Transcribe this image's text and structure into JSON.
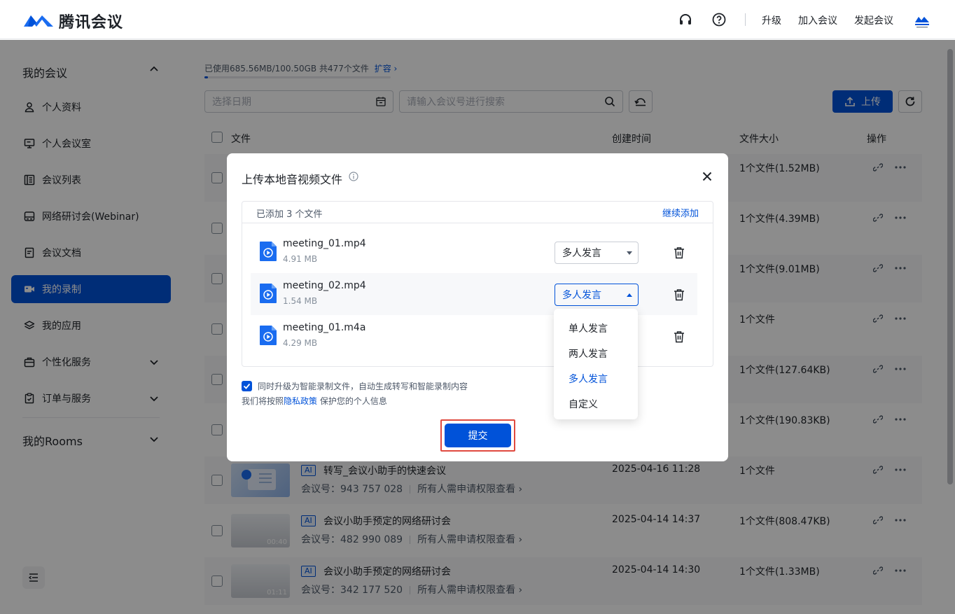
{
  "header": {
    "brand": "腾讯会议",
    "links": {
      "upgrade": "升级",
      "join": "加入会议",
      "start": "发起会议"
    }
  },
  "sidebar": {
    "my_meetings": "我的会议",
    "items": [
      {
        "label": "个人资料",
        "icon": "user-icon"
      },
      {
        "label": "个人会议室",
        "icon": "monitor-icon"
      },
      {
        "label": "会议列表",
        "icon": "list-icon"
      },
      {
        "label": "网络研讨会(Webinar)",
        "icon": "webinar-icon"
      },
      {
        "label": "会议文档",
        "icon": "document-icon"
      },
      {
        "label": "我的录制",
        "icon": "video-icon"
      },
      {
        "label": "我的应用",
        "icon": "layers-icon"
      },
      {
        "label": "个性化服务",
        "icon": "briefcase-icon"
      },
      {
        "label": "订单与服务",
        "icon": "clipboard-icon"
      }
    ],
    "my_rooms": "我的Rooms"
  },
  "storage": {
    "text": "已使用685.56MB/100.50GB  共477个文件",
    "expand": "扩容",
    "used_fraction": 0.007
  },
  "filters": {
    "date_placeholder": "选择日期",
    "search_placeholder": "请输入会议号进行搜索"
  },
  "toolbar": {
    "upload": "上传"
  },
  "table": {
    "headers": {
      "file": "文件",
      "created": "创建时间",
      "size": "文件大小",
      "actions": "操作"
    },
    "rows": [
      {
        "size": "1个文件(1.52MB)"
      },
      {
        "size": "1个文件(4.39MB)"
      },
      {
        "size": "1个文件(9.01MB)"
      },
      {
        "size": "1个文件"
      },
      {
        "size": "1个文件(127.64KB)"
      },
      {
        "size": "1个文件(190.83KB)"
      },
      {
        "title": "转写_会议小助手的快速会议",
        "meeting_no": "会议号：943 757 028",
        "perm": "所有人需申请权限查看",
        "time": "2025-04-16 11:28",
        "size": "1个文件",
        "tag": "AI"
      },
      {
        "title": "会议小助手预定的网络研讨会",
        "meeting_no": "会议号：482 990 089",
        "perm": "所有人需申请权限查看",
        "time": "2025-04-14 14:37",
        "size": "1个文件(808.47KB)",
        "tag": "AI",
        "duration": "00:40"
      },
      {
        "title": "会议小助手预定的网络研讨会",
        "meeting_no": "会议号：342 177 520",
        "perm": "所有人需申请权限查看",
        "time": "2025-04-14 14:30",
        "size": "1个文件(1.33MB)",
        "tag": "AI",
        "duration": "01:11"
      }
    ]
  },
  "modal": {
    "title": "上传本地音视频文件",
    "added": "已添加 3 个文件",
    "continue": "继续添加",
    "files": [
      {
        "name": "meeting_01.mp4",
        "size": "4.91 MB",
        "mode": "多人发言"
      },
      {
        "name": "meeting_02.mp4",
        "size": "1.54 MB",
        "mode": "多人发言"
      },
      {
        "name": "meeting_01.m4a",
        "size": "4.29 MB"
      }
    ],
    "agree": "同时升级为智能录制文件，自动生成转写和智能录制内容",
    "privacy_pre": "我们将按照",
    "privacy_link": "隐私政策",
    "privacy_post": "保护您的个人信息",
    "submit": "提交"
  },
  "dropdown": {
    "options": [
      "单人发言",
      "两人发言",
      "多人发言",
      "自定义"
    ],
    "selected": "多人发言"
  },
  "colors": {
    "accent": "#0052d9",
    "highlight_border": "#e04a3f"
  }
}
